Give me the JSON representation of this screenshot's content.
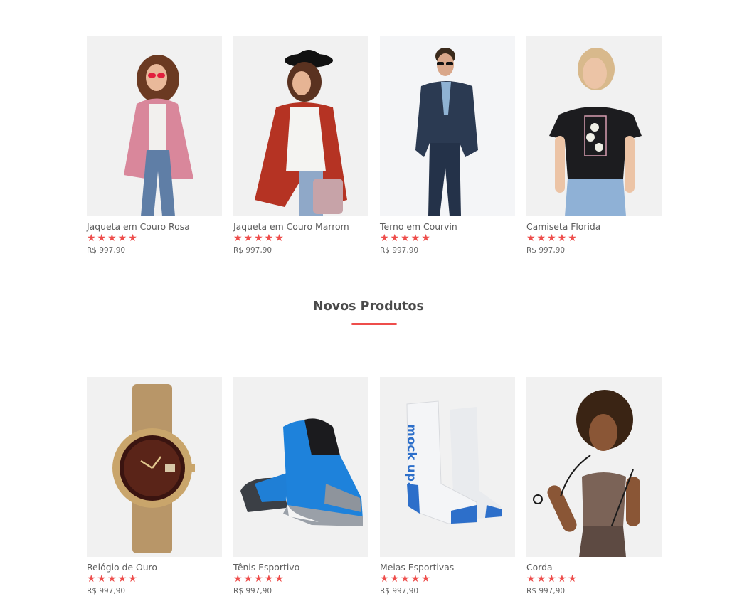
{
  "products_top": [
    {
      "name": "Jaqueta em Couro Rosa",
      "stars": "★★★★★",
      "price": "R$ 997,90",
      "image_icon": "woman-pink-jacket-image"
    },
    {
      "name": "Jaqueta em Couro Marrom",
      "stars": "★★★★★",
      "price": "R$ 997,90",
      "image_icon": "woman-red-jacket-image"
    },
    {
      "name": "Terno em Courvin",
      "stars": "★★★★★",
      "price": "R$ 997,90",
      "image_icon": "man-suit-image"
    },
    {
      "name": "Camiseta Florida",
      "stars": "★★★★★",
      "price": "R$ 997,90",
      "image_icon": "woman-floral-tshirt-image"
    }
  ],
  "section": {
    "title": "Novos Produtos",
    "accent": "#ee4d4b"
  },
  "products_new": [
    {
      "name": "Relógio de Ouro",
      "stars": "★★★★★",
      "price": "R$ 997,90",
      "image_icon": "gold-watch-image"
    },
    {
      "name": "Tênis Esportivo",
      "stars": "★★★★★",
      "price": "R$ 997,90",
      "image_icon": "blue-sneaker-image"
    },
    {
      "name": "Meias Esportivas",
      "stars": "★★★★★",
      "price": "R$ 997,90",
      "image_icon": "socks-image",
      "image_text": "mock up."
    },
    {
      "name": "Corda",
      "stars": "★★★★★",
      "price": "R$ 997,90",
      "image_icon": "jump-rope-woman-image"
    }
  ]
}
